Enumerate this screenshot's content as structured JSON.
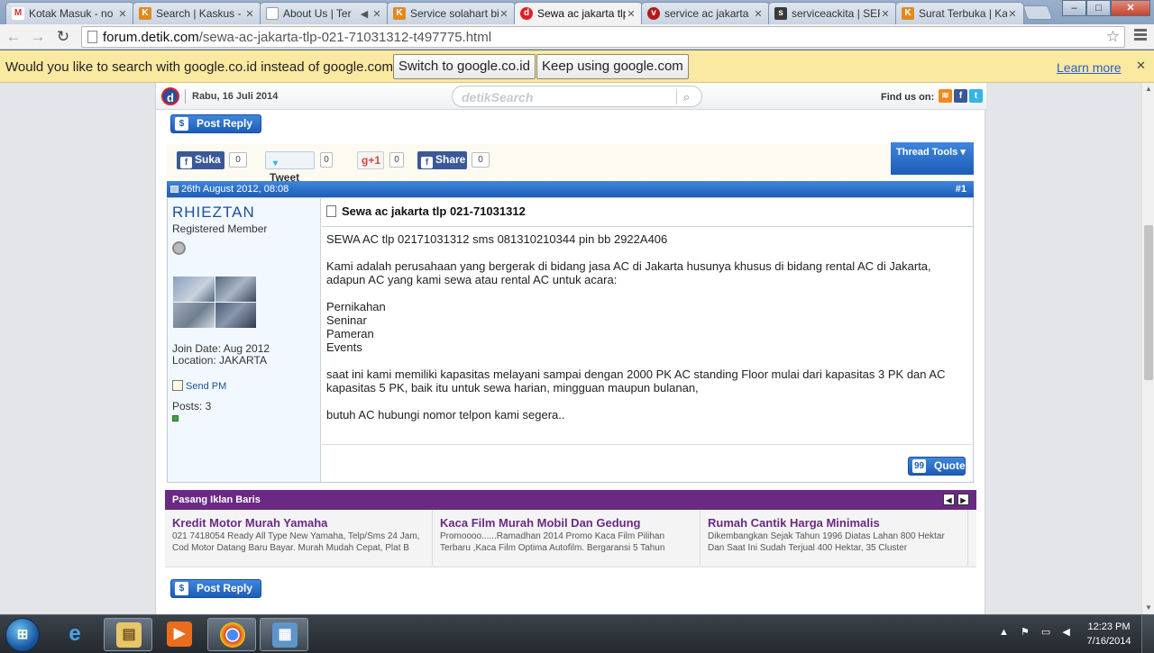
{
  "browser": {
    "tabs": [
      {
        "label": "Kotak Masuk - no",
        "icon": "gmail-icon",
        "color": "#d93025",
        "glyph": "M"
      },
      {
        "label": "Search | Kaskus - T",
        "icon": "kaskus-icon",
        "color": "#e08a1e",
        "glyph": "K"
      },
      {
        "label": "About Us | Ter",
        "icon": "page-icon",
        "color": "#8a8a8a",
        "glyph": ""
      },
      {
        "label": "Service solahart bi",
        "icon": "kaskus-icon",
        "color": "#e08a1e",
        "glyph": "K"
      },
      {
        "label": "Sewa ac jakarta tlp",
        "icon": "detik-icon",
        "color": "#e21f26",
        "glyph": "d"
      },
      {
        "label": "service ac jakarta",
        "icon": "shield-icon",
        "color": "#b11a1a",
        "glyph": "v"
      },
      {
        "label": "serviceackita | SER",
        "icon": "wordpress-icon",
        "color": "#3a3a3a",
        "glyph": "s"
      },
      {
        "label": "Surat Terbuka | Ka",
        "icon": "kaskus-icon",
        "color": "#e08a1e",
        "glyph": "K"
      }
    ],
    "active_tab": 4,
    "window_buttons": {
      "minimize": "–",
      "maximize": "□",
      "close": "✕"
    },
    "url_domain": "forum.detik.com",
    "url_path": "/sewa-ac-jakarta-tlp-021-71031312-t497775.html"
  },
  "infobar": {
    "message": "Would you like to search with google.co.id instead of google.com?",
    "switch_label": "Switch to google.co.id",
    "keep_label": "Keep using google.com",
    "learn_more": "Learn more"
  },
  "site_header": {
    "logo_letter": "d",
    "date": "Rabu, 16 Juli 2014",
    "search_placeholder": "detikSearch",
    "find_us": "Find us on:"
  },
  "thread": {
    "post_reply_label": "Post Reply",
    "share": {
      "suka_label": "Suka",
      "suka_count": "0",
      "tweet_label": "Tweet",
      "tweet_count": "0",
      "gplus_label": "+1",
      "gplus_count": "0",
      "share_label": "Share",
      "share_count": "0"
    },
    "thread_tools": "Thread Tools"
  },
  "post": {
    "date": "26th August 2012, 08:08",
    "number": "#1",
    "username": "RHIEZTAN",
    "rank": "Registered Member",
    "join_date": "Join Date: Aug 2012",
    "location": "Location: JAKARTA",
    "send_pm": "Send PM",
    "posts": "Posts: 3",
    "title": "Sewa ac jakarta tlp 021-71031312",
    "body": {
      "line1": "SEWA AC tlp 02171031312 sms 081310210344 pin bb 2922A406",
      "para2a": "Kami adalah perusahaan yang bergerak di bidang jasa AC di Jakarta husunya khusus di bidang rental AC di Jakarta,",
      "para2b": "adapun AC yang kami sewa atau rental AC untuk acara:",
      "item1": "Pernikahan",
      "item2": "Seninar",
      "item3": "Pameran",
      "item4": "Events",
      "para3a": "saat ini kami memiliki kapasitas melayani sampai dengan 2000 PK AC standing Floor mulai dari kapasitas 3 PK dan AC",
      "para3b": "kapasitas 5 PK, baik itu untuk sewa harian, mingguan maupun bulanan,",
      "para4": "butuh AC hubungi nomor telpon kami segera.."
    },
    "quote_label": "Quote"
  },
  "ads": {
    "header": "Pasang Iklan Baris",
    "items": [
      {
        "title": "Kredit Motor Murah Yamaha",
        "desc": "021 7418054 Ready All Type New Yamaha, Telp/Sms 24 Jam, Cod Motor Datang Baru Bayar. Murah Mudah Cepat, Plat B"
      },
      {
        "title": "Kaca Film Murah Mobil Dan Gedung",
        "desc": "Promoooo......Ramadhan 2014 Promo Kaca Film Pilihan Terbaru ,Kaca Film Optima Autofilm. Bergaransi 5 Tahun"
      },
      {
        "title": "Rumah Cantik Harga Minimalis",
        "desc": "Dikembangkan Sejak Tahun 1996 Diatas Lahan 800 Hektar Dan Saat Ini Sudah Terjual 400 Hektar, 35 Cluster"
      }
    ]
  },
  "taskbar": {
    "time": "12:23 PM",
    "date": "7/16/2014"
  },
  "colors": {
    "forum_blue": "#1d5db8",
    "ad_purple": "#6a2a84",
    "infobar_yellow": "#f9e9a1"
  }
}
